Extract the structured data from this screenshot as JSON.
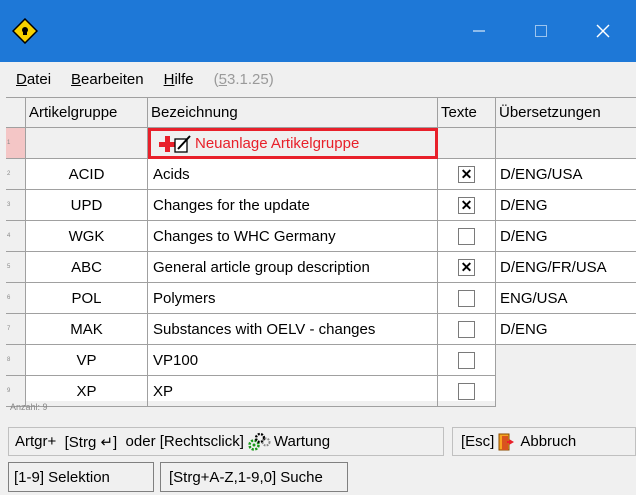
{
  "window": {
    "minimize_glyph": "—",
    "close_glyph": "✕"
  },
  "menu": {
    "file": {
      "key": "D",
      "rest": "atei"
    },
    "edit": {
      "key": "B",
      "rest": "earbeiten"
    },
    "help": {
      "key": "H",
      "rest": "ilfe"
    },
    "version": {
      "open": "(",
      "key": "5",
      "rest": "3.1.25)"
    }
  },
  "table": {
    "headers": {
      "code": "Artikelgruppe",
      "description": "Bezeichnung",
      "texts": "Texte",
      "translations": "Übersetzungen"
    },
    "new_row": {
      "row_number": "1",
      "label": "Neuanlage Artikelgruppe"
    },
    "rows": [
      {
        "num": "2",
        "code": "ACID",
        "description": "Acids",
        "texts": "☒",
        "translations": "D/ENG/USA"
      },
      {
        "num": "3",
        "code": "UPD",
        "description": "Changes for the update",
        "texts": "☒",
        "translations": "D/ENG"
      },
      {
        "num": "4",
        "code": "WGK",
        "description": "Changes to WHC Germany",
        "texts": "",
        "translations": "D/ENG"
      },
      {
        "num": "5",
        "code": "ABC",
        "description": "General article group description",
        "texts": "☒",
        "translations": "D/ENG/FR/USA"
      },
      {
        "num": "6",
        "code": "POL",
        "description": "Polymers",
        "texts": "",
        "translations": "ENG/USA"
      },
      {
        "num": "7",
        "code": "MAK",
        "description": "Substances with OELV - changes",
        "texts": "",
        "translations": "D/ENG"
      },
      {
        "num": "8",
        "code": "VP",
        "description": "VP100",
        "texts": "",
        "translations": ""
      },
      {
        "num": "9",
        "code": "XP",
        "description": "XP",
        "texts": "",
        "translations": ""
      }
    ],
    "count_label": "Anzahl: 9"
  },
  "actions": {
    "artgr_label": "Artgr+",
    "shortcut_label": "[Strg ↵]",
    "rightclick_label": "oder [Rechtsclick]",
    "maintenance_label": "Wartung",
    "esc_label": "[Esc]",
    "cancel_label": "Abbruch"
  },
  "footer": {
    "selection_label": "[1-9] Selektion",
    "search_label": "[Strg+A-Z,1-9,0] Suche"
  },
  "colors": {
    "titlebar": "#1e78d7",
    "highlight": "#e8202a"
  }
}
